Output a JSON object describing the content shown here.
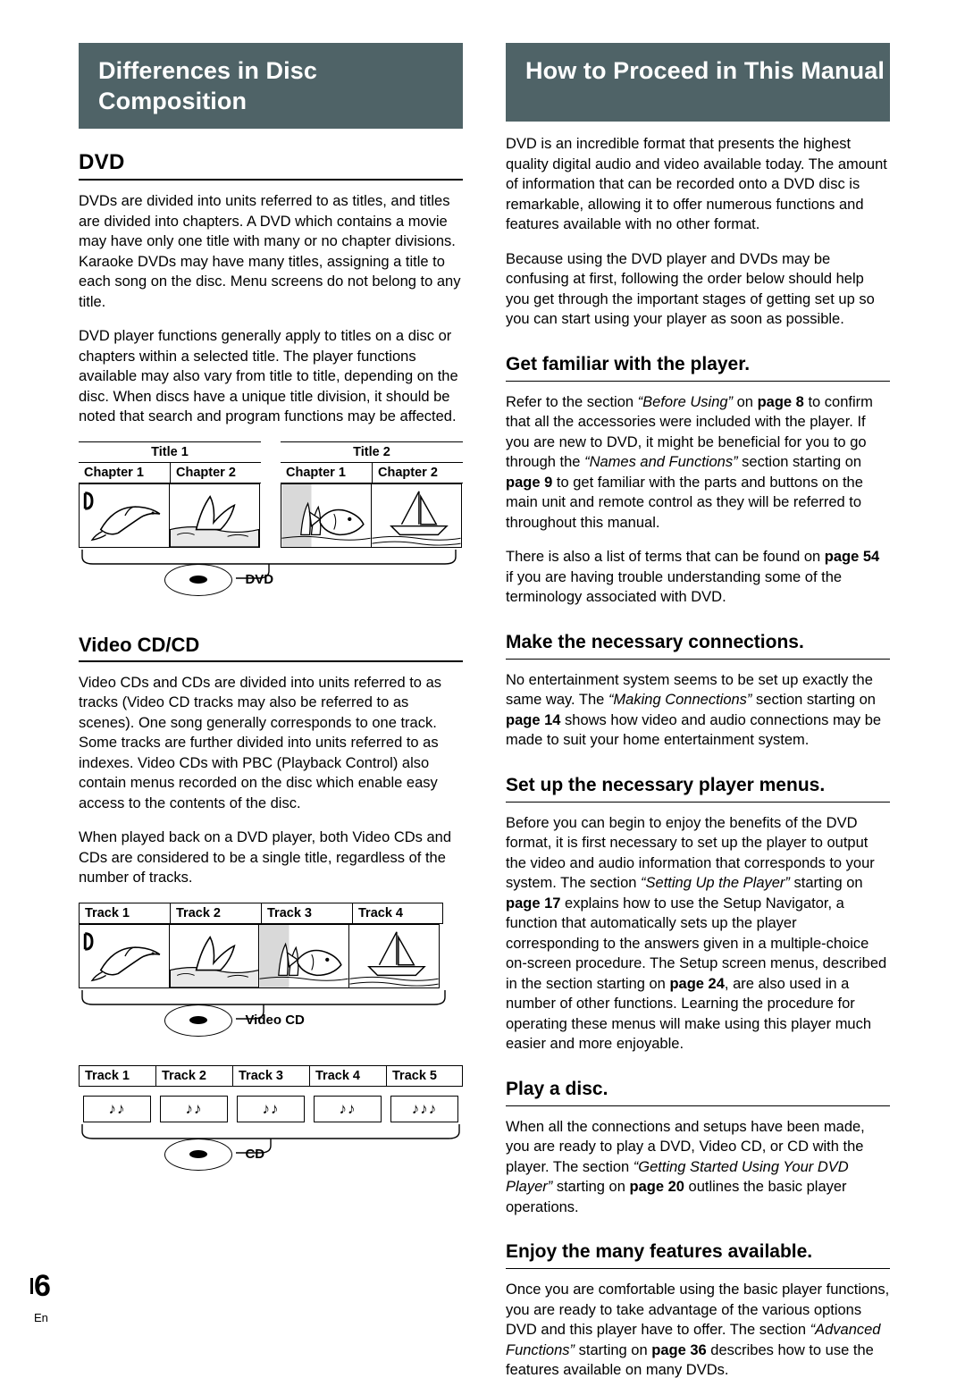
{
  "page": {
    "number": "6",
    "lang_code": "En"
  },
  "left_column": {
    "banner_title": "Differences in Disc Composition",
    "dvd_heading": "DVD",
    "dvd_paragraphs": [
      "DVDs are divided into units referred to as titles, and titles are divided into chapters. A DVD which contains a movie may have only one title with many or no chapter divisions. Karaoke DVDs may have many titles, assigning a title to each song on the disc. Menu screens do not belong to any title.",
      "DVD player functions generally apply to titles on a disc or chapters within a selected title. The player functions available may also vary from title to title, depending on the disc. When discs have a unique title division, it should be noted that search and program functions may be affected."
    ],
    "dvd_figure": {
      "titles": [
        "Title 1",
        "Title 2"
      ],
      "chapters": [
        "Chapter 1",
        "Chapter 2",
        "Chapter 1",
        "Chapter 2"
      ],
      "disc_label": "DVD"
    },
    "videocd_heading": "Video CD/CD",
    "videocd_paragraphs": [
      "Video CDs and CDs are divided into units referred to as tracks (Video CD tracks may also be referred to as scenes). One song generally corresponds to one track. Some tracks are further divided into units referred to as indexes. Video CDs with PBC (Playback Control) also contain menus recorded on the disc which enable easy access to the contents of the disc.",
      "When played back on a DVD player, both Video CDs and CDs are considered to be a single title, regardless of the number of tracks."
    ],
    "videocd_figure": {
      "tracks": [
        "Track 1",
        "Track 2",
        "Track 3",
        "Track 4"
      ],
      "disc_label": "Video CD"
    },
    "cd_figure": {
      "tracks": [
        "Track 1",
        "Track 2",
        "Track 3",
        "Track 4",
        "Track 5"
      ],
      "note_glyphs": [
        "♪♪",
        "♪♪",
        "♪♪",
        "♪♪",
        "♪♪♪"
      ],
      "disc_label": "CD"
    }
  },
  "right_column": {
    "banner_title": "How to Proceed in This Manual",
    "intro_paragraphs": [
      "DVD is an incredible format that presents the highest quality digital audio and video available today. The amount of information that can be recorded onto a DVD disc is remarkable, allowing it to offer numerous functions and features available with no other format.",
      "Because using the DVD player and DVDs may be confusing at first, following the order below should help you get through the important stages of getting set up so you can start using your player as soon as possible."
    ],
    "sections": [
      {
        "heading": "Get familiar with the player.",
        "paragraphs": [
          "Refer to the section “Before Using” on page 8 to confirm that all the accessories were included with the player. If you are new to DVD, it might be beneficial for you to go through the “Names and Functions” section starting on page 9 to get familiar with the parts and buttons on the main unit and remote control as they will be referred to throughout this manual.",
          "There is also a list of terms that can be found on page 54 if you are having trouble understanding some of the terminology associated with DVD."
        ]
      },
      {
        "heading": "Make the necessary connections.",
        "paragraphs": [
          "No entertainment system seems to be set up exactly the same way. The “Making Connections” section starting on page 14 shows how video and audio connections may be made to suit your home entertainment system."
        ]
      },
      {
        "heading": "Set up the necessary player menus.",
        "paragraphs": [
          "Before you can begin to enjoy the benefits of the DVD format, it is first necessary to set up the player to output the video and audio information that corresponds to your system. The section “Setting Up the Player” starting on page 17 explains how to use the Setup Navigator, a function that automatically sets up the player corresponding to the answers given in a multiple-choice on-screen procedure. The Setup screen menus, described in the section starting on page 24, are also used in a number of other functions. Learning the procedure for operating these menus will make using this player much easier and more enjoyable."
        ]
      },
      {
        "heading": "Play a disc.",
        "paragraphs": [
          "When all the connections and setups have been made, you are ready to play a DVD, Video CD, or CD with the player. The section “Getting Started Using Your DVD Player” starting on page 20 outlines the basic player operations."
        ]
      },
      {
        "heading": "Enjoy the many features available.",
        "paragraphs": [
          "Once you are comfortable using the basic player functions, you are ready to take advantage of the various options DVD and this player have to offer. The section “Advanced Functions” starting on page 36 describes how to use the features available on many DVDs."
        ]
      }
    ]
  },
  "colors": {
    "banner_bg": "#4f6367",
    "text": "#000000",
    "page_bg": "#ffffff"
  }
}
